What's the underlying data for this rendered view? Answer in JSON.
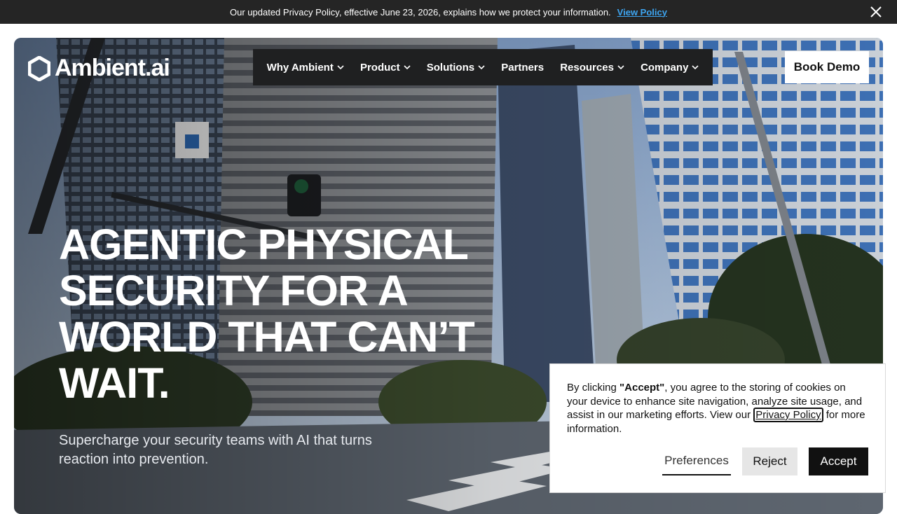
{
  "announcement": {
    "text": "Our updated Privacy Policy, effective June 23, 2026, explains how we protect your information.",
    "link_label": "View Policy",
    "close_icon": "close-icon"
  },
  "header": {
    "logo_text": "Ambient.ai",
    "logo_icon": "hexagon-logo-icon",
    "nav": [
      {
        "label": "Why Ambient",
        "has_dropdown": true
      },
      {
        "label": "Product",
        "has_dropdown": true
      },
      {
        "label": "Solutions",
        "has_dropdown": true
      },
      {
        "label": "Partners",
        "has_dropdown": false
      },
      {
        "label": "Resources",
        "has_dropdown": true
      },
      {
        "label": "Company",
        "has_dropdown": true
      }
    ],
    "cta_label": "Book Demo"
  },
  "hero": {
    "headline_lines": [
      "AGENTIC PHYSICAL",
      "SECURITY FOR A",
      "WORLD THAT CAN’T",
      "WAIT."
    ],
    "subhead_lines": [
      "Supercharge your security teams with AI that turns",
      "reaction into prevention."
    ],
    "background": "city-street-skyscrapers-image"
  },
  "cookie_banner": {
    "prefix": "By clicking ",
    "accept_quote": "\"Accept\"",
    "middle": ", you agree to the storing of cookies on your device to enhance site navigation, analyze site usage, and assist in our marketing efforts. View our ",
    "privacy_link": "Privacy Policy",
    "suffix": " for more information.",
    "preferences_label": "Preferences",
    "reject_label": "Reject",
    "accept_label": "Accept"
  },
  "colors": {
    "announce_bg": "#252525",
    "link_blue": "#3ea6f2",
    "nav_bg": "#1f2021",
    "accept_bg": "#111111",
    "reject_bg": "#e6e6e6"
  }
}
